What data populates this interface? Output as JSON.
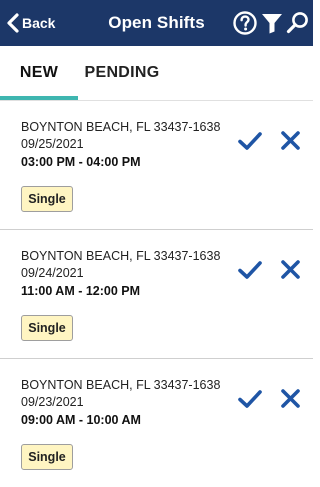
{
  "header": {
    "back_label": "Back",
    "title": "Open Shifts",
    "icons": [
      "back-chevron-icon",
      "help-icon",
      "filter-icon",
      "search-icon"
    ],
    "background_color": "#1c3768"
  },
  "tabs": [
    {
      "label": "NEW",
      "active": true
    },
    {
      "label": "PENDING",
      "active": false
    }
  ],
  "tab_indicator_color": "#3eb6b0",
  "shifts": [
    {
      "location": "BOYNTON BEACH, FL 33437-1638",
      "date": "09/25/2021",
      "time": "03:00 PM - 04:00 PM",
      "type": "Single"
    },
    {
      "location": "BOYNTON BEACH, FL 33437-1638",
      "date": "09/24/2021",
      "time": "11:00 AM - 12:00 PM",
      "type": "Single"
    },
    {
      "location": "BOYNTON BEACH, FL 33437-1638",
      "date": "09/23/2021",
      "time": "09:00 AM - 10:00 AM",
      "type": "Single"
    }
  ],
  "action_icons": {
    "accept": "check-icon",
    "reject": "close-icon",
    "color": "#1f55a5"
  },
  "badge_color": "#fff5c2"
}
